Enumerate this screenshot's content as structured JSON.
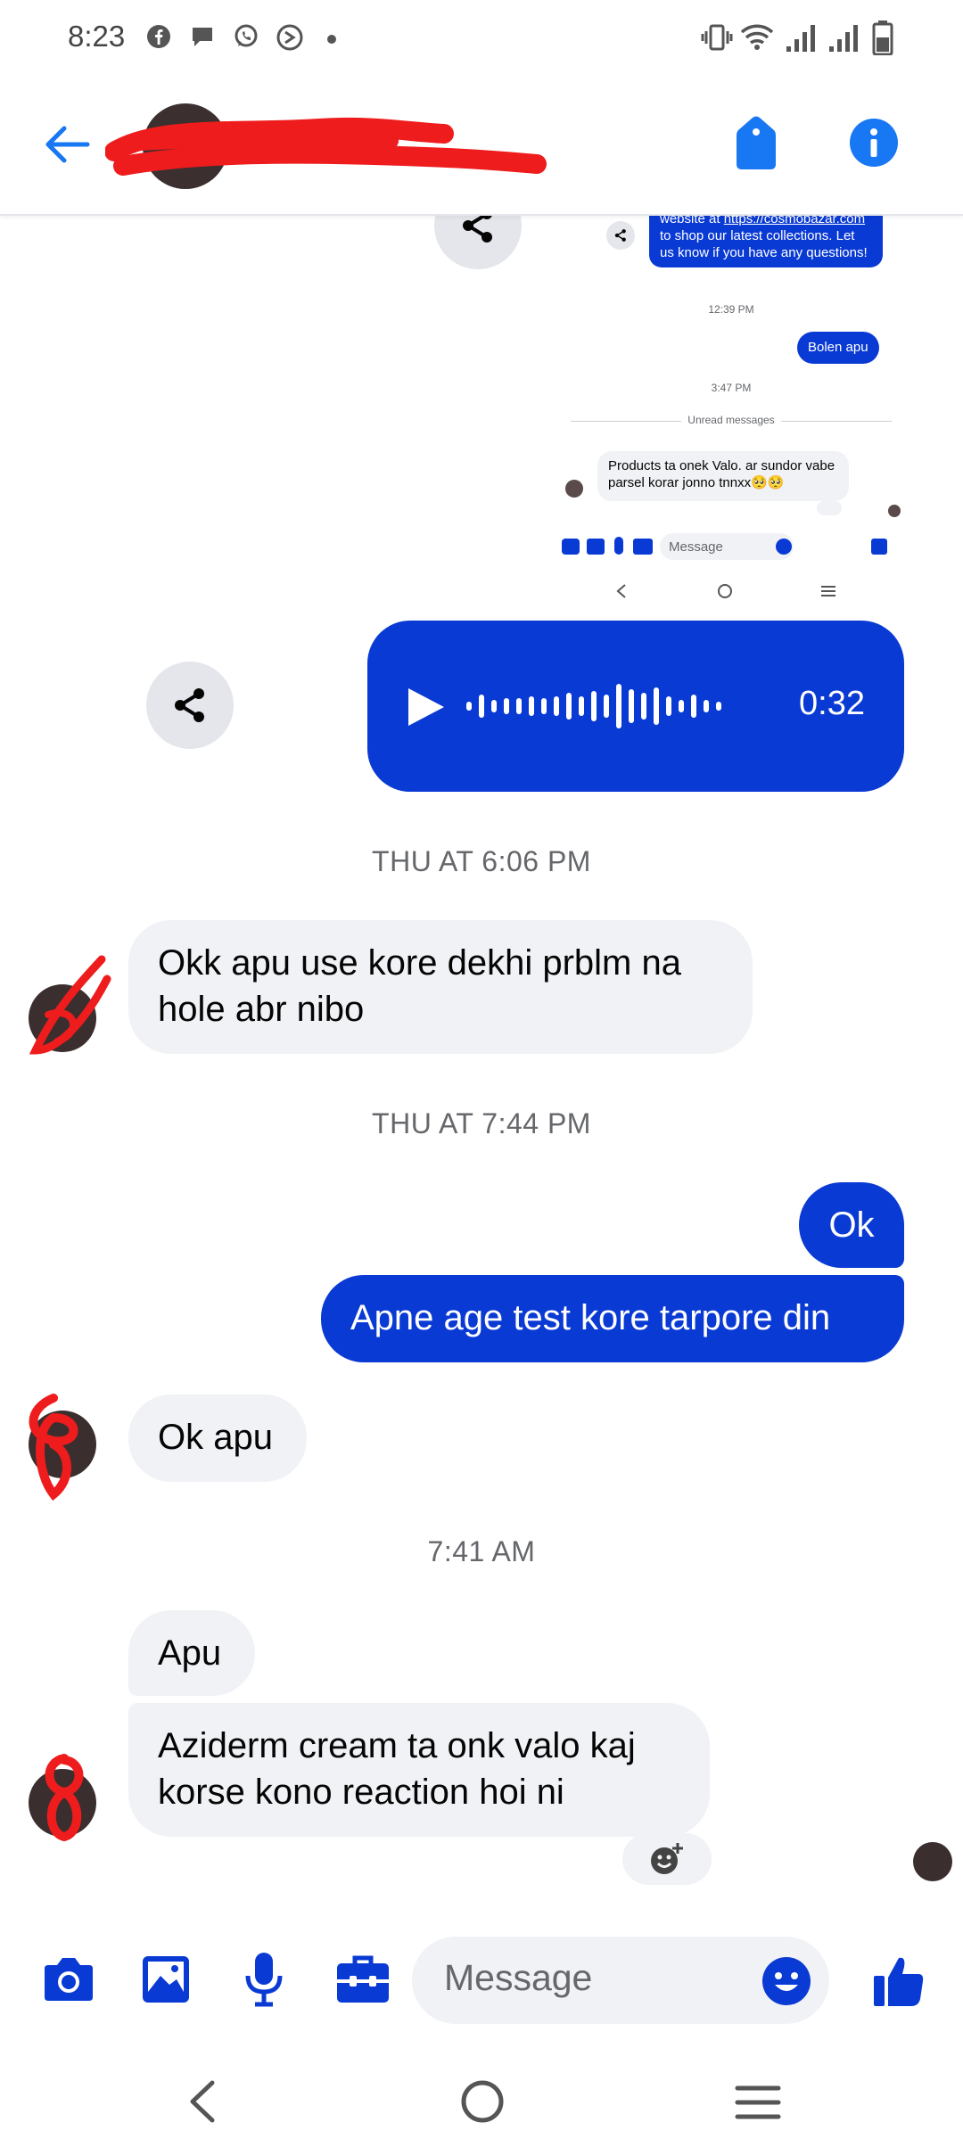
{
  "status_bar": {
    "time": "8:23"
  },
  "header": {
    "contact_name": "",
    "back_icon": "arrow-left-icon",
    "tag_icon": "tag-icon",
    "info_icon": "info-icon"
  },
  "thumbnail": {
    "top_message": "website at https://cosmobazar.com to shop our latest collections. Let us know if you have any questions!",
    "top_message_prefix": "website at ",
    "top_message_link": "https://cosmobazar.com",
    "top_message_suffix": " to shop our latest collections. Let us know if you have any questions!",
    "stamp1": "12:39 PM",
    "sent_message": "Bolen apu",
    "stamp2": "3:47 PM",
    "divider": "Unread messages",
    "received_message": "Products ta onek Valo. ar sundor vabe parsel korar jonno tnnxx🥺🥺",
    "input_placeholder": "Message"
  },
  "voice_message": {
    "duration": "0:32"
  },
  "messages": [
    {
      "type": "timestamp",
      "text": "THU AT 6:06 PM"
    },
    {
      "type": "incoming",
      "text": "Okk apu use kore dekhi prblm na hole abr nibo"
    },
    {
      "type": "timestamp",
      "text": "THU AT 7:44 PM"
    },
    {
      "type": "outgoing",
      "text": "Ok"
    },
    {
      "type": "outgoing",
      "text": "Apne age test kore tarpore din"
    },
    {
      "type": "incoming",
      "text": "Ok apu"
    },
    {
      "type": "timestamp",
      "text": "7:41 AM"
    },
    {
      "type": "incoming",
      "text": "Apu"
    },
    {
      "type": "incoming",
      "text": "Aziderm cream ta onk valo kaj korse kono reaction hoi ni"
    }
  ],
  "composer": {
    "placeholder": "Message",
    "icons": [
      "camera-icon",
      "gallery-icon",
      "microphone-icon",
      "toolbox-icon",
      "emoji-icon",
      "thumbs-up-icon"
    ]
  },
  "colors": {
    "accent": "#0a3ad4",
    "incoming_bg": "#f0f2f5",
    "icon_blue": "#1877f2"
  }
}
